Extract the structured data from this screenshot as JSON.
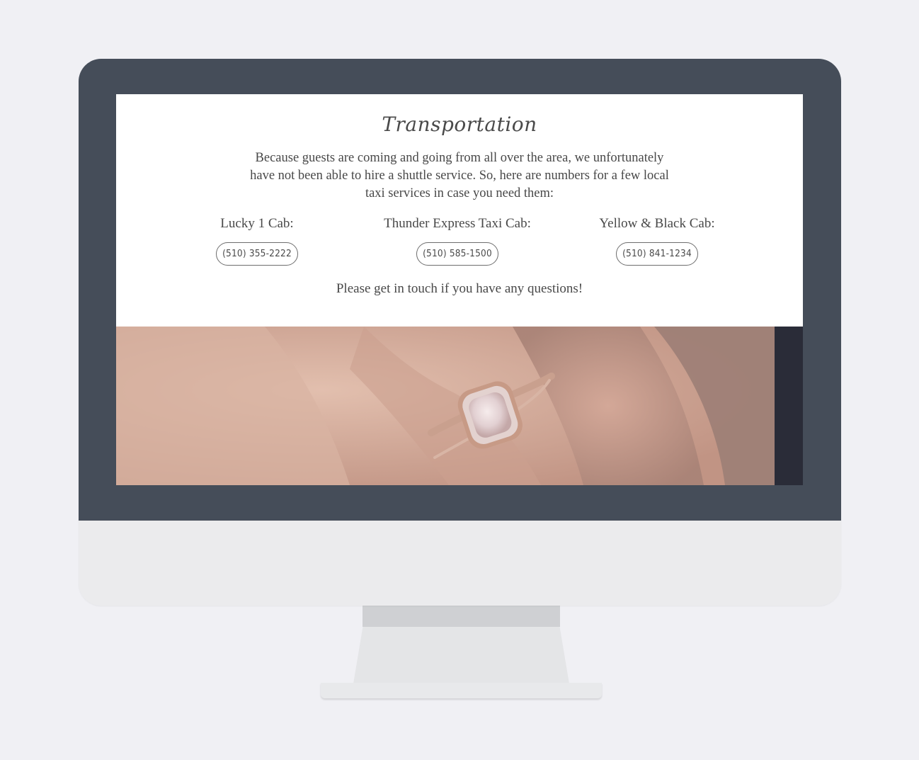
{
  "page": {
    "title": "Transportation",
    "intro": "Because guests are coming and going from all over the area, we unfortunately have not been able to hire a shuttle service. So, here are numbers for a few local taxi services in case you need them:",
    "cabs": [
      {
        "name": "Lucky 1 Cab:",
        "phone": "(510) 355-2222"
      },
      {
        "name": "Thunder Express Taxi Cab:",
        "phone": "(510) 585-1500"
      },
      {
        "name": "Yellow & Black Cab:",
        "phone": "(510) 841-1234"
      }
    ],
    "closing": "Please get in touch if you have any questions!"
  },
  "colors": {
    "bezel": "#454d59",
    "chin": "#ebebed",
    "background": "#f0f0f4",
    "text": "#484848"
  }
}
